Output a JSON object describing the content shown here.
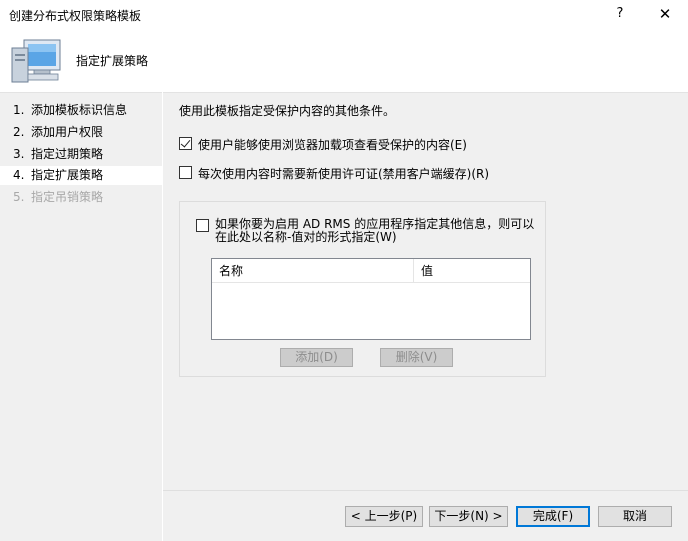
{
  "window": {
    "title": "创建分布式权限策略模板",
    "help_label": "?",
    "close_label": "✕"
  },
  "header": {
    "title": "指定扩展策略",
    "icon": "computer-icon"
  },
  "steps": [
    {
      "num": "1.",
      "label": "添加模板标识信息"
    },
    {
      "num": "2.",
      "label": "添加用户权限"
    },
    {
      "num": "3.",
      "label": "指定过期策略"
    },
    {
      "num": "4.",
      "label": "指定扩展策略"
    },
    {
      "num": "5.",
      "label": "指定吊销策略"
    }
  ],
  "main": {
    "intro": "使用此模板指定受保护内容的其他条件。",
    "option_browser": {
      "label": "使用户能够使用浏览器加载项查看受保护的内容(E)",
      "checked": true
    },
    "option_license": {
      "label": "每次使用内容时需要新使用许可证(禁用客户端缓存)(R)",
      "checked": false
    },
    "group": {
      "option_extra": {
        "label": "如果你要为启用 AD RMS 的应用程序指定其他信息，则可以在此处以名称-值对的形式指定(W)",
        "checked": false
      },
      "columns": [
        "名称",
        "值"
      ],
      "add_label": "添加(D)",
      "delete_label": "删除(V)"
    }
  },
  "footer": {
    "prev_label": "< 上一步(P)",
    "next_label": "下一步(N) >",
    "finish_label": "完成(F)",
    "cancel_label": "取消"
  }
}
